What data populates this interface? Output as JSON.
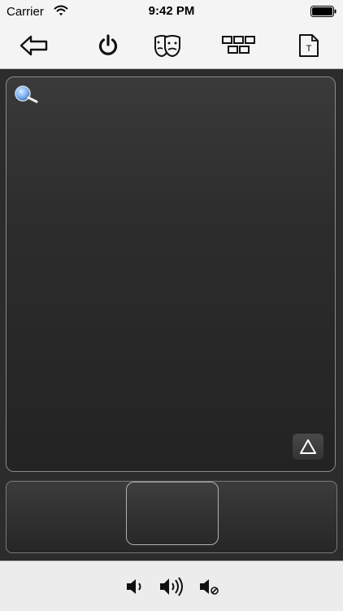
{
  "status_bar": {
    "carrier": "Carrier",
    "time": "9:42 PM",
    "wifi_icon": "wifi-icon",
    "battery_icon": "battery-icon"
  },
  "toolbar": {
    "items": [
      {
        "icon": "back-arrow-icon"
      },
      {
        "icon": "power-icon"
      },
      {
        "icon": "faces-icon"
      },
      {
        "icon": "keyboard-grid-icon"
      },
      {
        "icon": "text-document-icon",
        "glyph": "T"
      }
    ]
  },
  "trackpad": {
    "magnifier_icon": "magnifier-icon",
    "keyboard_toggle_glyph": "△"
  },
  "mouse_buttons": [
    "left",
    "middle",
    "right"
  ],
  "volume": {
    "items": [
      {
        "icon": "volume-down-icon"
      },
      {
        "icon": "volume-up-icon"
      },
      {
        "icon": "volume-mute-icon"
      }
    ]
  },
  "colors": {
    "bar_background": "#f4f4f4",
    "pad_background": "#2c2c2c",
    "pad_border": "#8a8a8a",
    "magnifier_blue": "#7fb2f0"
  }
}
